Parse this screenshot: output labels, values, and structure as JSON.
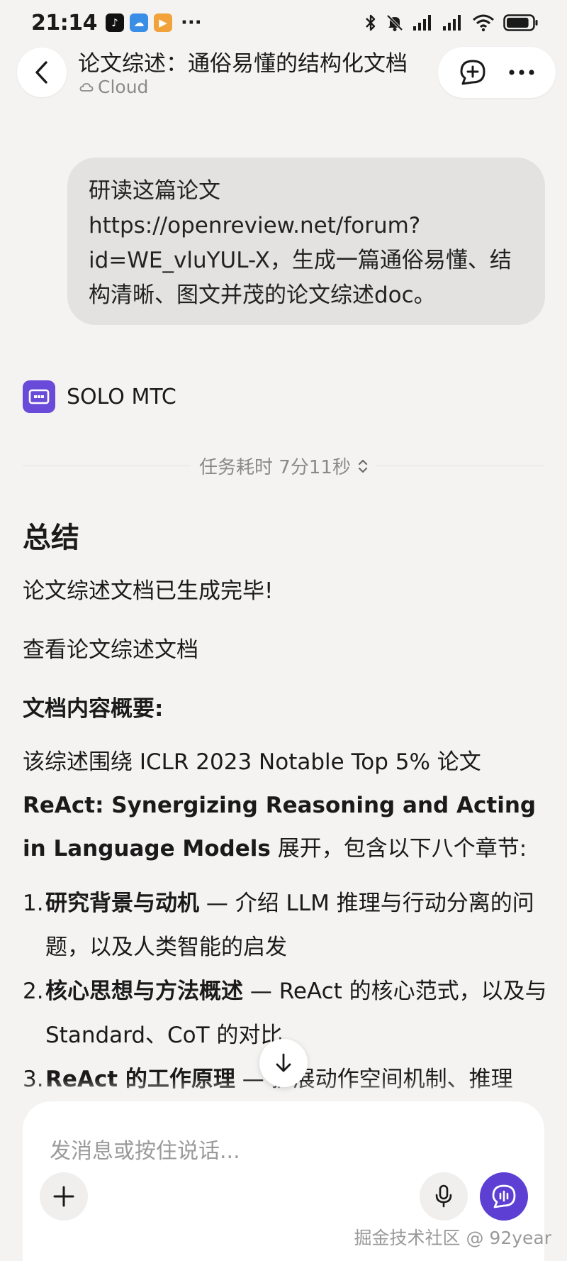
{
  "status_bar": {
    "time": "21:14",
    "apps": [
      {
        "icon": "tiktok-icon",
        "color": "#111111"
      },
      {
        "icon": "cloud-app-icon",
        "color": "#3a8ee6"
      },
      {
        "icon": "video-app-icon",
        "color": "#f2a23a"
      }
    ],
    "more": "···",
    "battery_level": 0.85
  },
  "header": {
    "title": "论文综述：通俗易懂的结构化文档",
    "subtitle": "Cloud"
  },
  "user_message": "研读这篇论文 https://openreview.net/forum?id=WE_vluYUL-X，生成一篇通俗易懂、结构清晰、图文并茂的论文综述doc。",
  "assistant": {
    "name": "SOLO MTC",
    "task_time": "任务耗时 7分11秒",
    "summary_heading": "总结",
    "summary_line": "论文综述文档已生成完毕!",
    "view_link": "查看论文综述文档",
    "overview_label": "文档内容概要:",
    "overview_intro": "该综述围绕 ICLR 2023 Notable Top 5% 论文",
    "paper_title": "ReAct: Synergizing Reasoning and Acting in Language Models",
    "overview_suffix": " 展开，包含以下八个章节:",
    "sections": [
      {
        "num": "1.",
        "title": "研究背景与动机",
        "desc": " — 介绍 LLM 推理与行动分离的问题，以及人类智能的启发"
      },
      {
        "num": "2.",
        "title": "核心思想与方法概述",
        "desc": " — ReAct 的核心范式，以及与 Standard、CoT 的对比"
      },
      {
        "num": "3.",
        "title": "ReAct 的工作原理",
        "desc": " — 扩展动作空间机制、推理"
      }
    ]
  },
  "composer": {
    "placeholder": "发消息或按住说话..."
  },
  "watermark": "掘金技术社区 @ 92year",
  "colors": {
    "background": "#f4f3f2",
    "accent": "#5d3fd3",
    "bubble": "#e3e2e1"
  }
}
